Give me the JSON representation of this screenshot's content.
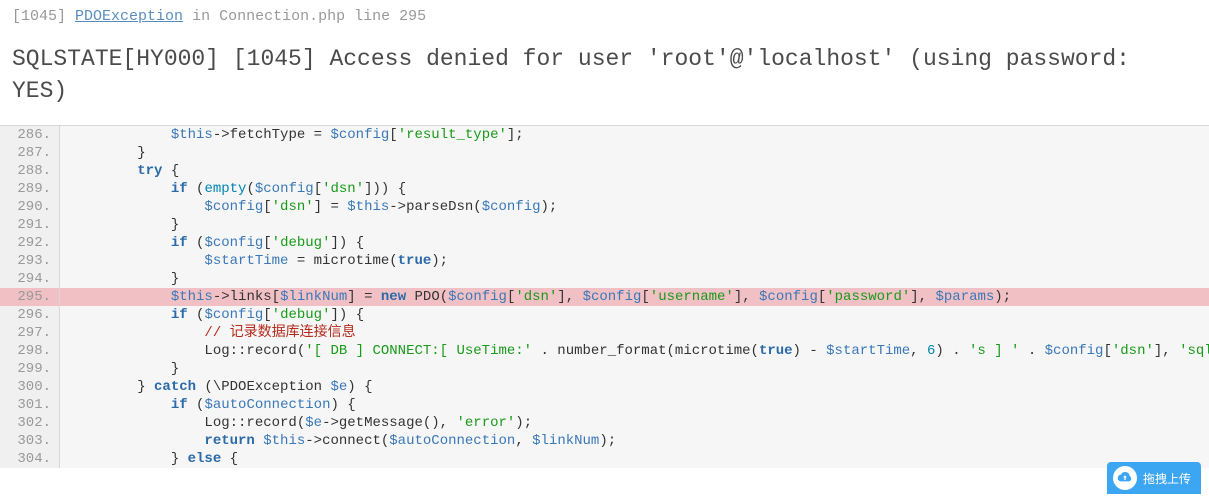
{
  "header": {
    "error_code": "[1045]",
    "exception_link": "PDOException",
    "in_word": "in",
    "location": "Connection.php line 295"
  },
  "title": "SQLSTATE[HY000] [1045] Access denied for user 'root'@'localhost' (using password: YES)",
  "highlight_line": 295,
  "code_lines": [
    {
      "n": 286,
      "segs": [
        {
          "c": "punc",
          "t": "            "
        },
        {
          "c": "var",
          "t": "$this"
        },
        {
          "c": "punc",
          "t": "->fetchType = "
        },
        {
          "c": "var",
          "t": "$config"
        },
        {
          "c": "punc",
          "t": "["
        },
        {
          "c": "strg",
          "t": "'result_type'"
        },
        {
          "c": "punc",
          "t": "];"
        }
      ]
    },
    {
      "n": 287,
      "segs": [
        {
          "c": "punc",
          "t": "        }"
        }
      ]
    },
    {
      "n": 288,
      "segs": [
        {
          "c": "punc",
          "t": "        "
        },
        {
          "c": "key",
          "t": "try"
        },
        {
          "c": "punc",
          "t": " {"
        }
      ]
    },
    {
      "n": 289,
      "segs": [
        {
          "c": "punc",
          "t": "            "
        },
        {
          "c": "key",
          "t": "if"
        },
        {
          "c": "punc",
          "t": " ("
        },
        {
          "c": "kw2",
          "t": "empty"
        },
        {
          "c": "punc",
          "t": "("
        },
        {
          "c": "var",
          "t": "$config"
        },
        {
          "c": "punc",
          "t": "["
        },
        {
          "c": "strg",
          "t": "'dsn'"
        },
        {
          "c": "punc",
          "t": "])) {"
        }
      ]
    },
    {
      "n": 290,
      "segs": [
        {
          "c": "punc",
          "t": "                "
        },
        {
          "c": "var",
          "t": "$config"
        },
        {
          "c": "punc",
          "t": "["
        },
        {
          "c": "strg",
          "t": "'dsn'"
        },
        {
          "c": "punc",
          "t": "] = "
        },
        {
          "c": "var",
          "t": "$this"
        },
        {
          "c": "punc",
          "t": "->parseDsn("
        },
        {
          "c": "var",
          "t": "$config"
        },
        {
          "c": "punc",
          "t": ");"
        }
      ]
    },
    {
      "n": 291,
      "segs": [
        {
          "c": "punc",
          "t": "            }"
        }
      ]
    },
    {
      "n": 292,
      "segs": [
        {
          "c": "punc",
          "t": "            "
        },
        {
          "c": "key",
          "t": "if"
        },
        {
          "c": "punc",
          "t": " ("
        },
        {
          "c": "var",
          "t": "$config"
        },
        {
          "c": "punc",
          "t": "["
        },
        {
          "c": "strg",
          "t": "'debug'"
        },
        {
          "c": "punc",
          "t": "]) {"
        }
      ]
    },
    {
      "n": 293,
      "segs": [
        {
          "c": "punc",
          "t": "                "
        },
        {
          "c": "var",
          "t": "$startTime"
        },
        {
          "c": "punc",
          "t": " = microtime("
        },
        {
          "c": "key",
          "t": "true"
        },
        {
          "c": "punc",
          "t": ");"
        }
      ]
    },
    {
      "n": 294,
      "segs": [
        {
          "c": "punc",
          "t": "            }"
        }
      ]
    },
    {
      "n": 295,
      "segs": [
        {
          "c": "punc",
          "t": "            "
        },
        {
          "c": "var",
          "t": "$this"
        },
        {
          "c": "punc",
          "t": "->links["
        },
        {
          "c": "var",
          "t": "$linkNum"
        },
        {
          "c": "punc",
          "t": "] = "
        },
        {
          "c": "key",
          "t": "new"
        },
        {
          "c": "punc",
          "t": " PDO("
        },
        {
          "c": "var",
          "t": "$config"
        },
        {
          "c": "punc",
          "t": "["
        },
        {
          "c": "strg",
          "t": "'dsn'"
        },
        {
          "c": "punc",
          "t": "], "
        },
        {
          "c": "var",
          "t": "$config"
        },
        {
          "c": "punc",
          "t": "["
        },
        {
          "c": "strg",
          "t": "'username'"
        },
        {
          "c": "punc",
          "t": "], "
        },
        {
          "c": "var",
          "t": "$config"
        },
        {
          "c": "punc",
          "t": "["
        },
        {
          "c": "strg",
          "t": "'password'"
        },
        {
          "c": "punc",
          "t": "], "
        },
        {
          "c": "var",
          "t": "$params"
        },
        {
          "c": "punc",
          "t": ");"
        }
      ]
    },
    {
      "n": 296,
      "segs": [
        {
          "c": "punc",
          "t": "            "
        },
        {
          "c": "key",
          "t": "if"
        },
        {
          "c": "punc",
          "t": " ("
        },
        {
          "c": "var",
          "t": "$config"
        },
        {
          "c": "punc",
          "t": "["
        },
        {
          "c": "strg",
          "t": "'debug'"
        },
        {
          "c": "punc",
          "t": "]) {"
        }
      ]
    },
    {
      "n": 297,
      "segs": [
        {
          "c": "punc",
          "t": "                "
        },
        {
          "c": "com",
          "t": "// 记录数据库连接信息"
        }
      ]
    },
    {
      "n": 298,
      "segs": [
        {
          "c": "punc",
          "t": "                Log::record("
        },
        {
          "c": "strg",
          "t": "'[ DB ] CONNECT:[ UseTime:'"
        },
        {
          "c": "punc",
          "t": " . number_format(microtime("
        },
        {
          "c": "key",
          "t": "true"
        },
        {
          "c": "punc",
          "t": ") - "
        },
        {
          "c": "var",
          "t": "$startTime"
        },
        {
          "c": "punc",
          "t": ", "
        },
        {
          "c": "kw2",
          "t": "6"
        },
        {
          "c": "punc",
          "t": ") . "
        },
        {
          "c": "strg",
          "t": "'s ] '"
        },
        {
          "c": "punc",
          "t": " . "
        },
        {
          "c": "var",
          "t": "$config"
        },
        {
          "c": "punc",
          "t": "["
        },
        {
          "c": "strg",
          "t": "'dsn'"
        },
        {
          "c": "punc",
          "t": "], "
        },
        {
          "c": "strg",
          "t": "'sql'"
        },
        {
          "c": "punc",
          "t": ");"
        }
      ]
    },
    {
      "n": 299,
      "segs": [
        {
          "c": "punc",
          "t": "            }"
        }
      ]
    },
    {
      "n": 300,
      "segs": [
        {
          "c": "punc",
          "t": "        } "
        },
        {
          "c": "key",
          "t": "catch"
        },
        {
          "c": "punc",
          "t": " (\\PDOException "
        },
        {
          "c": "var",
          "t": "$e"
        },
        {
          "c": "punc",
          "t": ") {"
        }
      ]
    },
    {
      "n": 301,
      "segs": [
        {
          "c": "punc",
          "t": "            "
        },
        {
          "c": "key",
          "t": "if"
        },
        {
          "c": "punc",
          "t": " ("
        },
        {
          "c": "var",
          "t": "$autoConnection"
        },
        {
          "c": "punc",
          "t": ") {"
        }
      ]
    },
    {
      "n": 302,
      "segs": [
        {
          "c": "punc",
          "t": "                Log::record("
        },
        {
          "c": "var",
          "t": "$e"
        },
        {
          "c": "punc",
          "t": "->getMessage(), "
        },
        {
          "c": "strg",
          "t": "'error'"
        },
        {
          "c": "punc",
          "t": ");"
        }
      ]
    },
    {
      "n": 303,
      "segs": [
        {
          "c": "punc",
          "t": "                "
        },
        {
          "c": "key",
          "t": "return"
        },
        {
          "c": "punc",
          "t": " "
        },
        {
          "c": "var",
          "t": "$this"
        },
        {
          "c": "punc",
          "t": "->connect("
        },
        {
          "c": "var",
          "t": "$autoConnection"
        },
        {
          "c": "punc",
          "t": ", "
        },
        {
          "c": "var",
          "t": "$linkNum"
        },
        {
          "c": "punc",
          "t": ");"
        }
      ]
    },
    {
      "n": 304,
      "segs": [
        {
          "c": "punc",
          "t": "            } "
        },
        {
          "c": "key",
          "t": "else"
        },
        {
          "c": "punc",
          "t": " {"
        }
      ]
    }
  ],
  "upload_button": {
    "label": "拖拽上传"
  }
}
